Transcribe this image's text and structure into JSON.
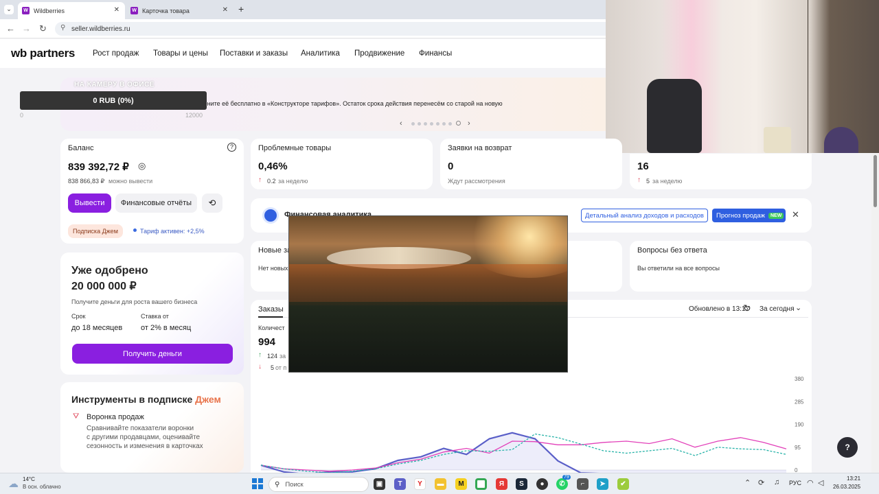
{
  "browser": {
    "tabs": [
      {
        "label": "Wildberries",
        "favicon": "W"
      },
      {
        "label": "Карточка товара",
        "favicon": "W"
      }
    ],
    "new_tab": "+",
    "url": "seller.wildberries.ru"
  },
  "header": {
    "logo": "wb partners",
    "nav": [
      "Рост продаж",
      "Товары и цены",
      "Поставки и заказы",
      "Аналитика",
      "Продвижение",
      "Финансы"
    ]
  },
  "banner": {
    "text": "ать другую, замените её бесплатно в «Конструкторе тарифов». Остаток срока действия перенесём со старой на новую"
  },
  "overlay": {
    "title": "НА КАМЕРУ В ОФИСЕ",
    "bar_label": "0 RUB (0%)",
    "min": "0",
    "max": "12000"
  },
  "balance": {
    "title": "Баланс",
    "amount": "839 392,72 ₽",
    "withdrawable": "838 866,83 ₽",
    "withdrawable_label": "можно вывести",
    "withdraw_button": "Вывести",
    "reports_button": "Финансовые отчёты",
    "subscription_tag": "Подписка Джем",
    "tariff": "Тариф активен: +2,5%"
  },
  "problem_goods": {
    "title": "Проблемные товары",
    "value": "0,46%",
    "delta": "0.2",
    "delta_label": "за неделю"
  },
  "returns": {
    "title": "Заявки на возврат",
    "value": "0",
    "sub": "Ждут рассмотрения"
  },
  "fourth": {
    "value": "16",
    "delta": "5",
    "delta_label": "за неделю"
  },
  "loan": {
    "title_line1": "Уже одобрено",
    "title_line2": "20 000 000 ₽",
    "description": "Получите деньги для роста вашего бизнеса",
    "term_label": "Срок",
    "term_value": "до 18 месяцев",
    "rate_label": "Ставка от",
    "rate_value": "от 2% в месяц",
    "button": "Получить деньги"
  },
  "tools": {
    "title_prefix": "Инструменты в подписке",
    "title_accent": "Джем",
    "item_title": "Воронка продаж",
    "item_desc_1": "Сравнивайте показатели воронки",
    "item_desc_2": "с другими продавцами, оценивайте",
    "item_desc_3": "сезонность и изменения в карточках"
  },
  "fin_analytics": {
    "title": "Финансовая аналитика",
    "link1": "Детальный анализ доходов и расходов",
    "link2": "Прогноз продаж",
    "badge": "NEW"
  },
  "new_orders": {
    "title": "Новые за",
    "sub": "Нет новых"
  },
  "questions": {
    "title": "Вопросы без ответа",
    "sub": "Вы ответили на все вопросы"
  },
  "orders": {
    "tab": "Заказы",
    "updated": "Обновлено в 13:17",
    "period": "За сегодня",
    "count_label": "Количест",
    "count": "994",
    "up_delta": "124",
    "up_label": "за",
    "down_delta": "5",
    "down_label": "от п"
  },
  "chart_data": {
    "type": "line",
    "y_ticks": [
      "380",
      "285",
      "190",
      "95",
      "0"
    ],
    "ylim": [
      0,
      380
    ],
    "series": [
      {
        "color": "#5a5fc8",
        "values": [
          20,
          -8,
          -18,
          -8,
          -8,
          5,
          40,
          55,
          90,
          65,
          130,
          155,
          130,
          38,
          -12,
          -15,
          -15,
          -15,
          -15,
          -15,
          -15,
          -15,
          -15,
          -15
        ]
      },
      {
        "color": "#e23fb9",
        "values": [
          20,
          5,
          0,
          -5,
          0,
          8,
          30,
          45,
          75,
          90,
          70,
          120,
          118,
          105,
          105,
          115,
          120,
          110,
          130,
          95,
          120,
          135,
          115,
          88
        ]
      },
      {
        "color": "#27b3a8",
        "values": [
          20,
          5,
          -5,
          -12,
          -5,
          5,
          25,
          40,
          65,
          80,
          78,
          85,
          150,
          135,
          108,
          80,
          70,
          80,
          90,
          60,
          95,
          88,
          85,
          65
        ]
      }
    ]
  },
  "taskbar": {
    "weather_temp": "14°C",
    "weather_desc": "В осн. облачно",
    "search": "Поиск",
    "lang": "РУС",
    "time": "13:21",
    "date": "26.03.2025",
    "badge_count": "79"
  },
  "help": "?"
}
